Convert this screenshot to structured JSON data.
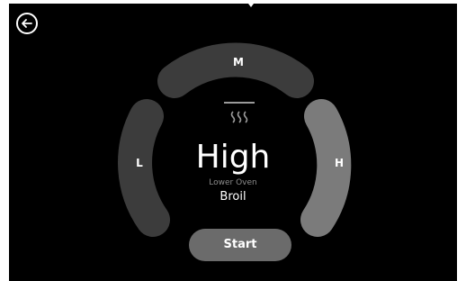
{
  "dial": {
    "levels": {
      "low": "L",
      "medium": "M",
      "high": "H"
    },
    "selected_level": "H"
  },
  "center": {
    "level": "High",
    "oven": "Lower Oven",
    "mode": "Broil"
  },
  "start_label": "Start",
  "icons": {
    "back": "arrow-left-icon",
    "heat": "broil-heat-icon"
  },
  "colors": {
    "background": "#000000",
    "segment_default": "#3c3c3c",
    "segment_selected": "#7b7b7b",
    "start_button": "#6b6b6b",
    "text": "#ffffff",
    "subtext": "#8c8c8c"
  }
}
